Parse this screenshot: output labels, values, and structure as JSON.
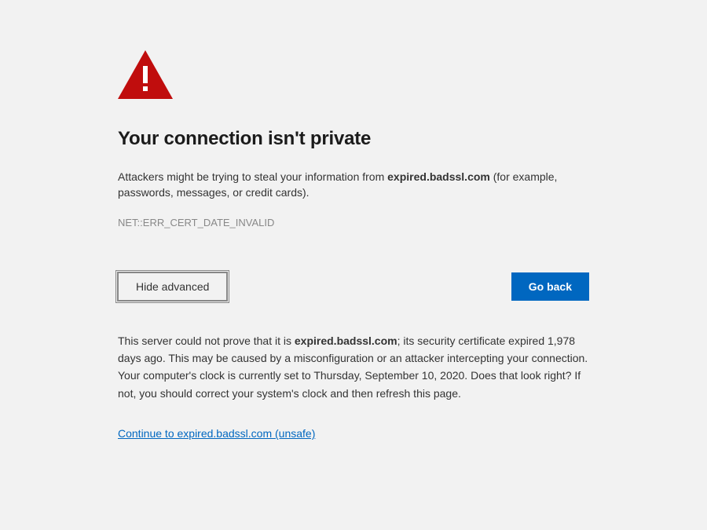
{
  "warning": {
    "iconColor": "#c00d0d",
    "title": "Your connection isn't private",
    "description_prefix": "Attackers might be trying to steal your information from ",
    "description_domain": "expired.badssl.com",
    "description_suffix": " (for example, passwords, messages, or credit cards).",
    "errorCode": "NET::ERR_CERT_DATE_INVALID"
  },
  "buttons": {
    "advanced": "Hide advanced",
    "back": "Go back"
  },
  "details": {
    "prefix": "This server could not prove that it is ",
    "domain": "expired.badssl.com",
    "suffix": "; its security certificate expired 1,978 days ago. This may be caused by a misconfiguration or an attacker intercepting your connection. Your computer's clock is currently set to Thursday, September 10, 2020. Does that look right? If not, you should correct your system's clock and then refresh this page."
  },
  "unsafeLink": "Continue to expired.badssl.com (unsafe)"
}
